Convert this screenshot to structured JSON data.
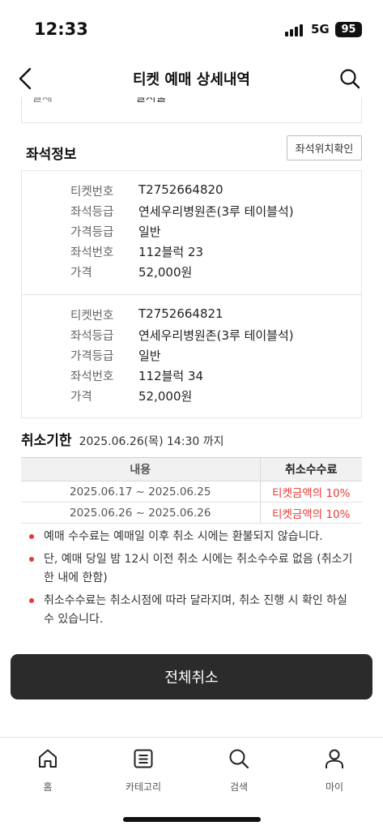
{
  "status_bar": {
    "time": "12:33",
    "network": "5G",
    "battery": "95"
  },
  "header": {
    "title": "티켓 예매 상세내역"
  },
  "top_box": {
    "label": "결제",
    "value": "일시불"
  },
  "seat_section": {
    "title": "좌석정보",
    "seat_map_button": "좌석위치확인",
    "labels": {
      "ticket_no": "티켓번호",
      "seat_grade": "좌석등급",
      "price_grade": "가격등급",
      "seat_no": "좌석번호",
      "price": "가격"
    },
    "tickets": [
      {
        "ticket_no": "T2752664820",
        "seat_grade": "연세우리병원존(3루 테이블석)",
        "price_grade": "일반",
        "seat_no": "112블럭 23",
        "price": "52,000원"
      },
      {
        "ticket_no": "T2752664821",
        "seat_grade": "연세우리병원존(3루 테이블석)",
        "price_grade": "일반",
        "seat_no": "112블럭 34",
        "price": "52,000원"
      }
    ]
  },
  "cancel_section": {
    "title": "취소기한",
    "deadline": "2025.06.26(목) 14:30 까지",
    "table_headers": {
      "content": "내용",
      "fee": "취소수수료"
    },
    "rows": [
      {
        "period": "2025.06.17 ~ 2025.06.25",
        "fee": "티켓금액의 10%"
      },
      {
        "period": "2025.06.26 ~ 2025.06.26",
        "fee": "티켓금액의 10%"
      }
    ],
    "notes": [
      "예매 수수료는 예매일 이후 취소 시에는 환불되지 않습니다.",
      "단, 예매 당일 밤 12시 이전 취소 시에는 취소수수료 없음 (취소기한 내에 한함)",
      "취소수수료는 취소시점에 따라 달라지며, 취소 진행 시 확인 하실 수 있습니다."
    ]
  },
  "cancel_all_button": "전체취소",
  "bottom_nav": [
    {
      "label": "홈",
      "icon": "home-icon"
    },
    {
      "label": "카테고리",
      "icon": "list-icon"
    },
    {
      "label": "검색",
      "icon": "search-icon"
    },
    {
      "label": "마이",
      "icon": "person-icon"
    }
  ]
}
